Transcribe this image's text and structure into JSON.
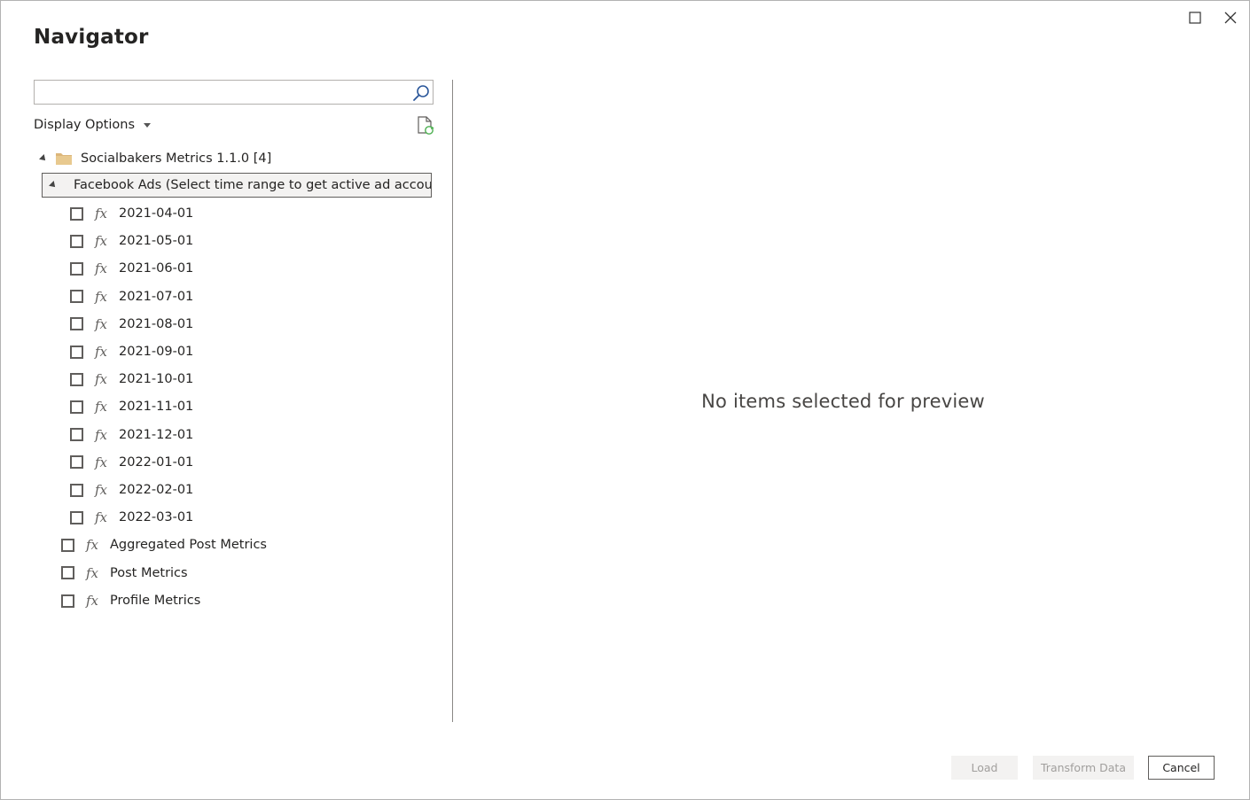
{
  "window": {
    "title": "Navigator"
  },
  "search": {
    "placeholder": "",
    "value": ""
  },
  "display_options": {
    "label": "Display Options"
  },
  "tree": {
    "root": {
      "label": "Socialbakers Metrics 1.1.0 [4]"
    },
    "selected_node": {
      "label": "Facebook Ads (Select time range to get active ad account..."
    },
    "date_items": [
      "2021-04-01",
      "2021-05-01",
      "2021-06-01",
      "2021-07-01",
      "2021-08-01",
      "2021-09-01",
      "2021-10-01",
      "2021-11-01",
      "2021-12-01",
      "2022-01-01",
      "2022-02-01",
      "2022-03-01"
    ],
    "function_items": [
      "Aggregated Post Metrics",
      "Post Metrics",
      "Profile Metrics"
    ],
    "fx_symbol": "fx"
  },
  "preview": {
    "empty_message": "No items selected for preview"
  },
  "buttons": {
    "load": "Load",
    "transform": "Transform Data",
    "cancel": "Cancel"
  },
  "icons": {
    "maximize": "maximize-icon",
    "close": "close-icon",
    "search": "search-icon",
    "refresh": "refresh-document-icon",
    "folder": "folder-icon",
    "table": "table-icon",
    "function": "function-icon"
  },
  "colors": {
    "folder": "#dcb67a",
    "table": "#4a7fb5",
    "refresh_accent": "#4caf50"
  }
}
